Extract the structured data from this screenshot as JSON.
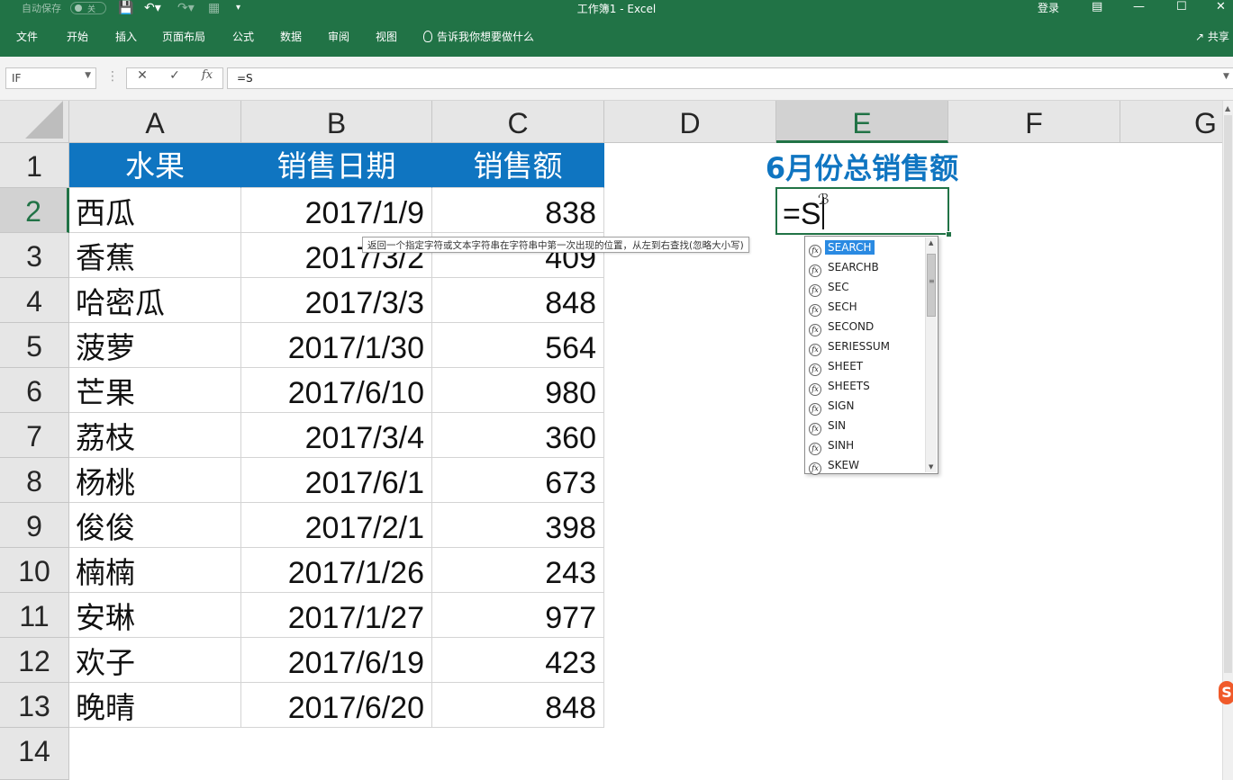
{
  "titlebar": {
    "autosave_label": "自动保存",
    "autosave_state": "关",
    "title": "工作簿1 - Excel",
    "login": "登录"
  },
  "ribbon": {
    "tabs": [
      "文件",
      "开始",
      "插入",
      "页面布局",
      "公式",
      "数据",
      "审阅",
      "视图"
    ],
    "tell_me": "告诉我你想要做什么",
    "share": "共享"
  },
  "formula_bar": {
    "name_box": "IF",
    "formula": "=S"
  },
  "columns": [
    "A",
    "B",
    "C",
    "D",
    "E",
    "F",
    "G"
  ],
  "rows": [
    "1",
    "2",
    "3",
    "4",
    "5",
    "6",
    "7",
    "8",
    "9",
    "10",
    "11",
    "12",
    "13",
    "14"
  ],
  "header_row": [
    "水果",
    "销售日期",
    "销售额"
  ],
  "table": [
    {
      "fruit": "西瓜",
      "date": "2017/1/9",
      "amount": "838"
    },
    {
      "fruit": "香蕉",
      "date": "2017/3/2",
      "amount": "409"
    },
    {
      "fruit": "哈密瓜",
      "date": "2017/3/3",
      "amount": "848"
    },
    {
      "fruit": "菠萝",
      "date": "2017/1/30",
      "amount": "564"
    },
    {
      "fruit": "芒果",
      "date": "2017/6/10",
      "amount": "980"
    },
    {
      "fruit": "荔枝",
      "date": "2017/3/4",
      "amount": "360"
    },
    {
      "fruit": "杨桃",
      "date": "2017/6/1",
      "amount": "673"
    },
    {
      "fruit": "俊俊",
      "date": "2017/2/1",
      "amount": "398"
    },
    {
      "fruit": "楠楠",
      "date": "2017/1/26",
      "amount": "243"
    },
    {
      "fruit": "安琳",
      "date": "2017/1/27",
      "amount": "977"
    },
    {
      "fruit": "欢子",
      "date": "2017/6/19",
      "amount": "423"
    },
    {
      "fruit": "晚晴",
      "date": "2017/6/20",
      "amount": "848"
    }
  ],
  "summary_title": "6月份总销售额",
  "edit_cell": {
    "value": "=S"
  },
  "tooltip": "返回一个指定字符或文本字符串在字符串中第一次出现的位置，从左到右查找(忽略大小写)",
  "autocomplete": {
    "items": [
      "SEARCH",
      "SEARCHB",
      "SEC",
      "SECH",
      "SECOND",
      "SERIESSUM",
      "SHEET",
      "SHEETS",
      "SIGN",
      "SIN",
      "SINH",
      "SKEW"
    ],
    "selected": "SEARCH"
  },
  "colors": {
    "excel_green": "#217346",
    "table_header": "#0f75c1",
    "selection_blue": "#2a8ae2"
  }
}
